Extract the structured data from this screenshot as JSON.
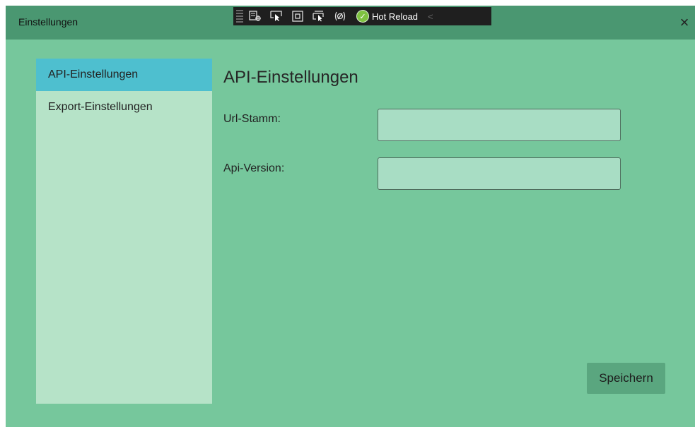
{
  "window": {
    "title": "Einstellungen",
    "close_symbol": "×"
  },
  "debug_toolbar": {
    "tools": [
      "select-element-icon",
      "pointer-icon",
      "display-layout-icon",
      "track-focus-icon",
      "binding-failures-icon"
    ],
    "hot_reload_label": "Hot Reload",
    "collapse_symbol": "<"
  },
  "sidebar": {
    "items": [
      {
        "label": "API-Einstellungen",
        "active": true
      },
      {
        "label": "Export-Einstellungen",
        "active": false
      }
    ]
  },
  "main": {
    "title": "API-Einstellungen",
    "fields": [
      {
        "label": "Url-Stamm:",
        "value": ""
      },
      {
        "label": "Api-Version:",
        "value": ""
      }
    ],
    "save_label": "Speichern"
  },
  "colors": {
    "window_bg": "#76c79c",
    "titlebar_bg": "#4a9771",
    "sidebar_bg": "#b6e3c8",
    "sidebar_active": "#4ebfcf",
    "field_bg": "#a8ddc4",
    "button_bg": "#5aa67f"
  }
}
